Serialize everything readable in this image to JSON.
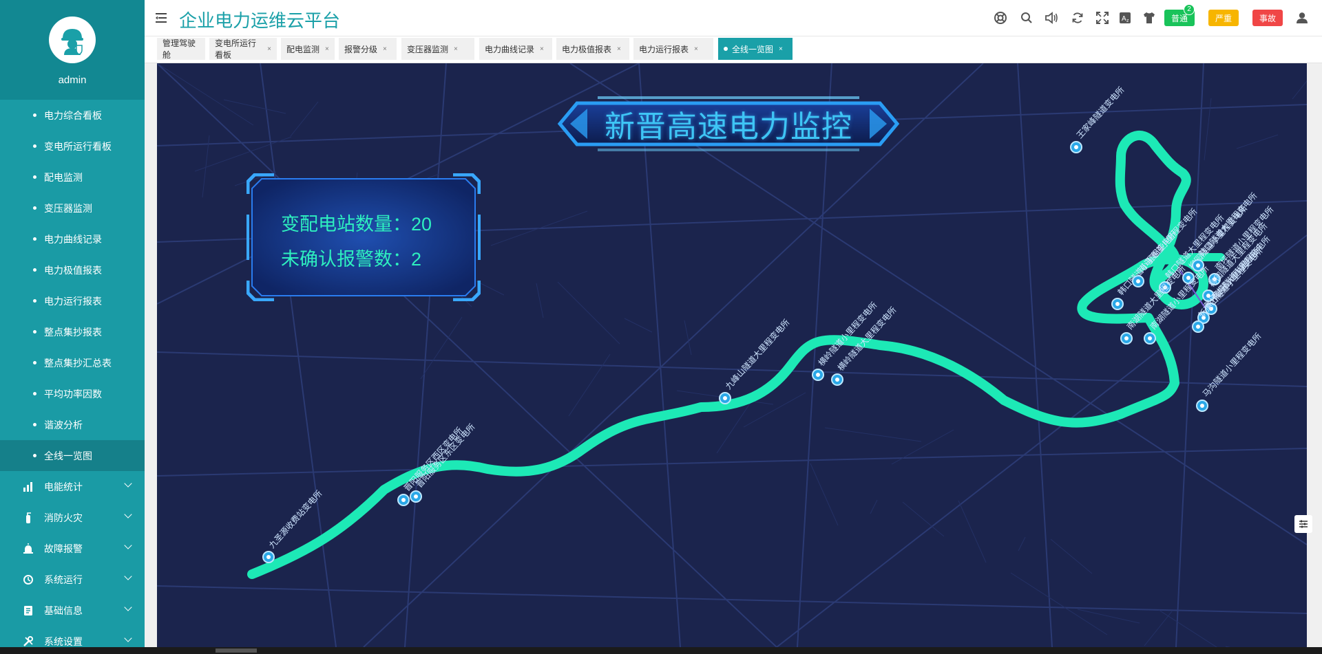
{
  "sidebar": {
    "user": "admin",
    "sub_items": [
      "电力综合看板",
      "变电所运行看板",
      "配电监测",
      "变压器监测",
      "电力曲线记录",
      "电力极值报表",
      "电力运行报表",
      "整点集抄报表",
      "整点集抄汇总表",
      "平均功率因数",
      "谐波分析",
      "全线一览图"
    ],
    "active_index": 11,
    "groups": [
      "电能统计",
      "消防火灾",
      "故障报警",
      "系统运行",
      "基础信息",
      "系统设置"
    ]
  },
  "header": {
    "title": "企业电力运维云平台",
    "alarm_normal": "普通",
    "alarm_normal_count": "2",
    "alarm_serious": "严重",
    "alarm_accident": "事故"
  },
  "tabs": [
    "管理驾驶舱",
    "变电所运行看板",
    "配电监测",
    "报警分级",
    "变压器监测",
    "电力曲线记录",
    "电力极值报表",
    "电力运行报表",
    "全线一览图"
  ],
  "active_tab": 8,
  "map": {
    "title": "新晋高速电力监控",
    "station_count_label": "变配电站数量：",
    "station_count": "20",
    "alarm_label": "未确认报警数：",
    "alarm_count": "2",
    "route_color": "#1de9b6",
    "stations": [
      "九圣源收费站变电所",
      "晋阳服务区西区变电所",
      "晋阳服务区东区变电所",
      "九峰山隧道大里程变电所",
      "横岭隧道小里程变电所",
      "横岭隧道大里程变电所",
      "韩口隧道小里程变电所",
      "南马隧道小里程变电所",
      "韩口隧道大里程变电所",
      "柳园隧道小里程变电所",
      "韩口隧道大里程变电所",
      "南坪隧道小里程变电所",
      "柳园隧道大里程变电所",
      "蒿坪隧道小里程变电所",
      "蒿坪隧道大里程变电所",
      "斩顶山隧道小里程变电所",
      "南湖隧道大里程变电所",
      "南湖隧道小里程变电所",
      "马沟隧道小里程变电所",
      "王家峰隧道变电所"
    ]
  }
}
